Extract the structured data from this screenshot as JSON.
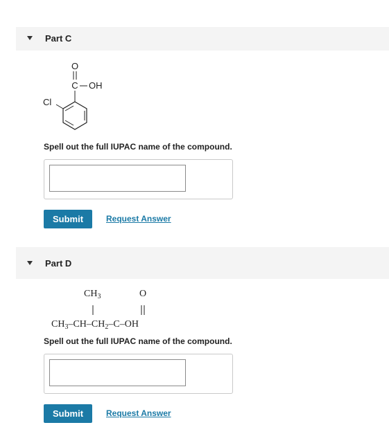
{
  "part_c": {
    "title": "Part C",
    "structure": {
      "carbonyl_o": "O",
      "carbon": "C",
      "oh": "OH",
      "chloro": "Cl"
    },
    "question": "Spell out the full IUPAC name of the compound.",
    "answer_value": "",
    "submit_label": "Submit",
    "request_label": "Request Answer"
  },
  "part_d": {
    "title": "Part D",
    "structure": {
      "top_ch3": "CH",
      "top_ch3_sub": "3",
      "top_o": "O",
      "ch3": "CH",
      "ch3_sub": "3",
      "ch": "CH",
      "ch2": "CH",
      "ch2_sub": "2",
      "c": "C",
      "oh": "OH"
    },
    "question": "Spell out the full IUPAC name of the compound.",
    "answer_value": "",
    "submit_label": "Submit",
    "request_label": "Request Answer"
  }
}
